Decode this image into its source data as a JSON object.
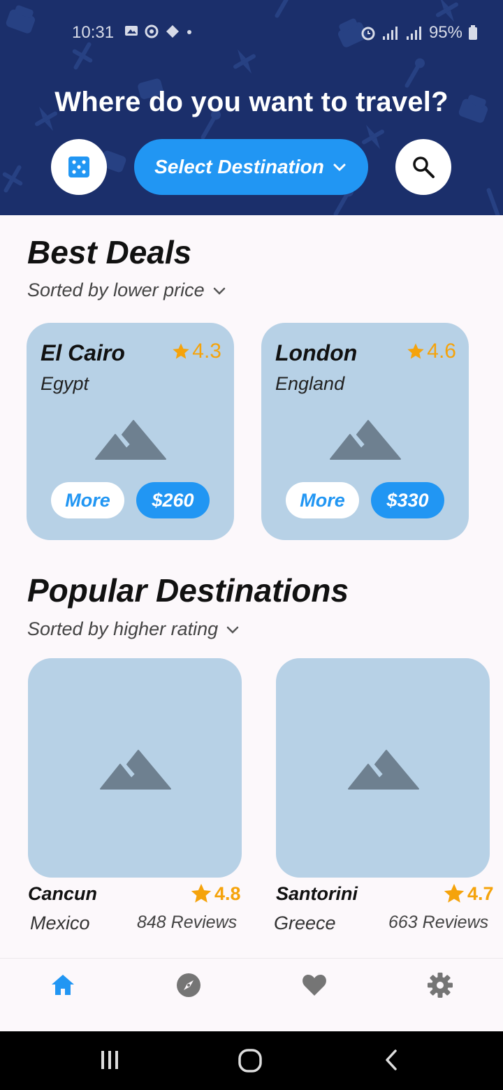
{
  "status_bar": {
    "time": "10:31",
    "battery": "95%"
  },
  "header": {
    "title": "Where do you want to travel?",
    "select_destination": "Select Destination"
  },
  "best_deals": {
    "title": "Best Deals",
    "sort_label": "Sorted by lower price",
    "cards": [
      {
        "city": "El Cairo",
        "country": "Egypt",
        "rating": "4.3",
        "more": "More",
        "price": "$260"
      },
      {
        "city": "London",
        "country": "England",
        "rating": "4.6",
        "more": "More",
        "price": "$330"
      }
    ]
  },
  "popular": {
    "title": "Popular Destinations",
    "sort_label": "Sorted by higher rating",
    "cards": [
      {
        "name": "Cancun",
        "country": "Mexico",
        "rating": "4.8",
        "reviews": "848 Reviews"
      },
      {
        "name": "Santorini",
        "country": "Greece",
        "rating": "4.7",
        "reviews": "663 Reviews"
      }
    ]
  },
  "nav": {
    "items": [
      "home-icon",
      "explore-icon",
      "favorite-icon",
      "settings-icon"
    ],
    "active_color": "#2196f3",
    "inactive_color": "#757575"
  },
  "colors": {
    "header_bg": "#1b2f6b",
    "accent": "#2196f3",
    "card_bg": "#b7d1e6",
    "star": "#f5a30b"
  }
}
